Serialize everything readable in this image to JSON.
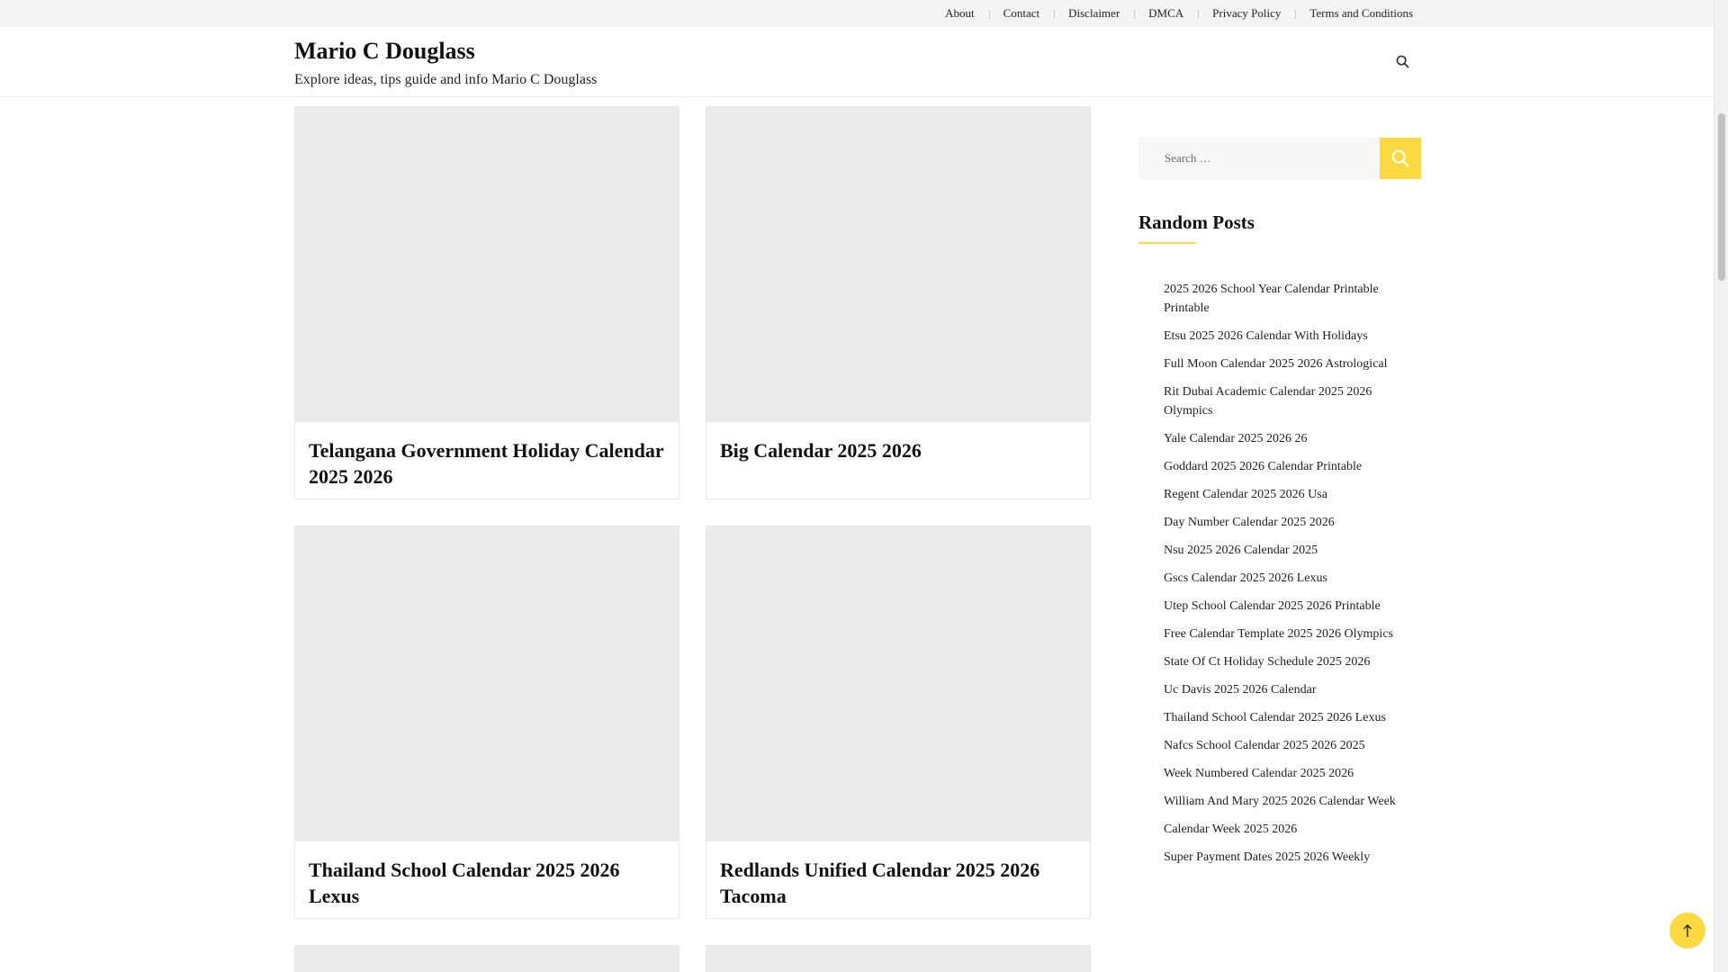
{
  "topnav": [
    "About",
    "Contact",
    "Disclaimer",
    "DMCA",
    "Privacy Policy",
    "Terms and Conditions"
  ],
  "site": {
    "title": "Mario C Douglass",
    "description": "Explore ideas, tips guide and info Mario C Douglass"
  },
  "posts": [
    {
      "title": "Telangana Government Holiday Calendar 2025 2026"
    },
    {
      "title": "Big Calendar 2025 2026"
    },
    {
      "title": "Thailand School Calendar 2025 2026 Lexus"
    },
    {
      "title": "Redlands Unified Calendar 2025 2026 Tacoma"
    }
  ],
  "sidebar": {
    "search_placeholder": "Search …",
    "widget_title": "Random Posts",
    "random_posts": [
      "2025 2026 School Year Calendar Printable Printable",
      "Etsu 2025 2026 Calendar With Holidays",
      "Full Moon Calendar 2025 2026 Astrological",
      "Rit Dubai Academic Calendar 2025 2026 Olympics",
      "Yale Calendar 2025 2026 26",
      "Goddard 2025 2026 Calendar Printable",
      "Regent Calendar 2025 2026 Usa",
      "Day Number Calendar 2025 2026",
      "Nsu 2025 2026 Calendar 2025",
      "Gscs Calendar 2025 2026 Lexus",
      "Utep School Calendar 2025 2026 Printable",
      "Free Calendar Template 2025 2026 Olympics",
      "State Of Ct Holiday Schedule 2025 2026",
      "Uc Davis 2025 2026 Calendar",
      "Thailand School Calendar 2025 2026 Lexus",
      "Nafcs School Calendar 2025 2026 2025",
      "Week Numbered Calendar 2025 2026",
      "William And Mary 2025 2026 Calendar Week",
      "Calendar Week 2025 2026",
      "Super Payment Dates 2025 2026 Weekly"
    ]
  },
  "colors": {
    "accent": "#fcd842",
    "thumb_placeholder": "#ebebeb",
    "topbar": "#f4f4f4"
  },
  "icons": {
    "header_search": "search-icon",
    "search_submit": "search-icon",
    "scroll_top": "arrow-up-icon"
  }
}
